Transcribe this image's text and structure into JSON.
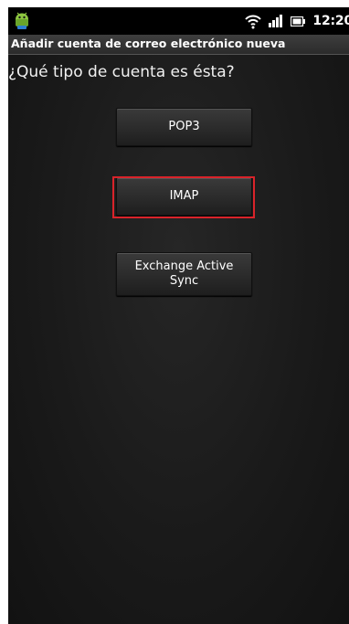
{
  "status_bar": {
    "time": "12:20",
    "icons": [
      "android-icon",
      "wifi-icon",
      "signal-icon",
      "battery-icon"
    ]
  },
  "title_bar": {
    "title": "Añadir cuenta de correo electrónico nueva"
  },
  "main": {
    "question": "¿Qué tipo de cuenta es ésta?",
    "options": [
      {
        "label": "POP3"
      },
      {
        "label": "IMAP"
      },
      {
        "label": "Exchange Active Sync"
      }
    ]
  },
  "colors": {
    "highlight": "#d9232a",
    "background": "#141414",
    "title_bar": "#333333"
  }
}
